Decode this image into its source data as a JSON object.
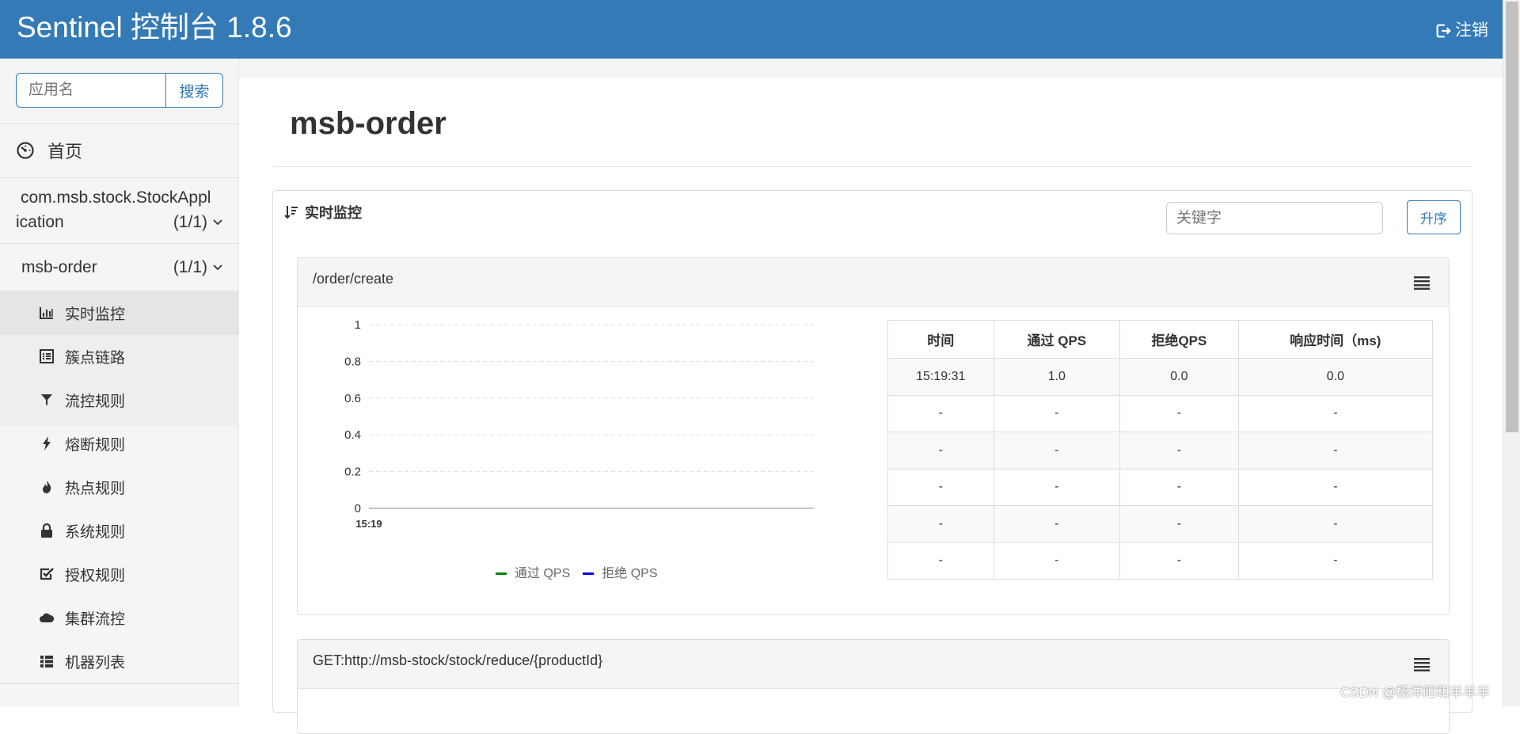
{
  "header": {
    "title": "Sentinel 控制台 1.8.6",
    "logout_label": "注销"
  },
  "sidebar": {
    "search_placeholder": "应用名",
    "search_button": "搜索",
    "home_label": "首页",
    "apps": [
      {
        "line1": "com.msb.stock.StockAppl",
        "line2": "ication",
        "count": "(1/1)"
      },
      {
        "line1": "msb-order",
        "count": "(1/1)"
      }
    ],
    "menu": [
      {
        "label": "实时监控",
        "icon": "bar-chart-icon"
      },
      {
        "label": "簇点链路",
        "icon": "list-alt-icon"
      },
      {
        "label": "流控规则",
        "icon": "filter-icon"
      },
      {
        "label": "熔断规则",
        "icon": "flash-icon"
      },
      {
        "label": "热点规则",
        "icon": "fire-icon"
      },
      {
        "label": "系统规则",
        "icon": "lock-icon"
      },
      {
        "label": "授权规则",
        "icon": "check-icon"
      },
      {
        "label": "集群流控",
        "icon": "cloud-icon"
      },
      {
        "label": "机器列表",
        "icon": "th-list-icon"
      }
    ]
  },
  "main": {
    "page_title": "msb-order",
    "panel_title": "实时监控",
    "keyword_placeholder": "关键字",
    "sort_button": "升序",
    "resources": [
      {
        "name": "/order/create",
        "table": {
          "headers": [
            "时间",
            "通过 QPS",
            "拒绝QPS",
            "响应时间（ms)"
          ],
          "rows": [
            [
              "15:19:31",
              "1.0",
              "0.0",
              "0.0"
            ],
            [
              "-",
              "-",
              "-",
              "-"
            ],
            [
              "-",
              "-",
              "-",
              "-"
            ],
            [
              "-",
              "-",
              "-",
              "-"
            ],
            [
              "-",
              "-",
              "-",
              "-"
            ],
            [
              "-",
              "-",
              "-",
              "-"
            ]
          ]
        }
      },
      {
        "name": "GET:http://msb-stock/stock/reduce/{productId}"
      }
    ]
  },
  "chart_data": {
    "type": "line",
    "x": [
      "15:19"
    ],
    "series": [
      {
        "name": "通过 QPS",
        "color": "#008000",
        "values": []
      },
      {
        "name": "拒绝 QPS",
        "color": "#0000ff",
        "values": []
      }
    ],
    "y_ticks": [
      "1",
      "0.8",
      "0.6",
      "0.4",
      "0.2",
      "0"
    ],
    "ylim": [
      0,
      1
    ],
    "grid": true,
    "legend": "bottom"
  },
  "watermark": "CSDN @杨洋阳和羊羊羊"
}
